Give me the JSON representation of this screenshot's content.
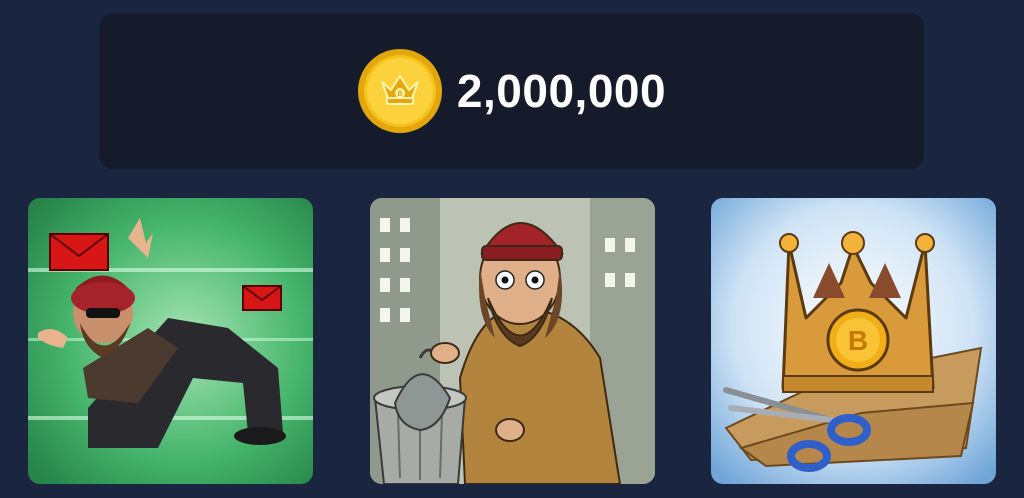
{
  "balance": {
    "value": "2,000,000",
    "icon": "crown-coin-icon",
    "coin_color": "#f5c518"
  },
  "cards": [
    {
      "icon": "fleeing-bearded-man-with-letters"
    },
    {
      "icon": "homeless-man-with-trash-can"
    },
    {
      "icon": "cardboard-crown-with-scissors"
    }
  ],
  "colors": {
    "background": "#1a2540",
    "panel": "#161b2c",
    "text": "#ffffff"
  }
}
